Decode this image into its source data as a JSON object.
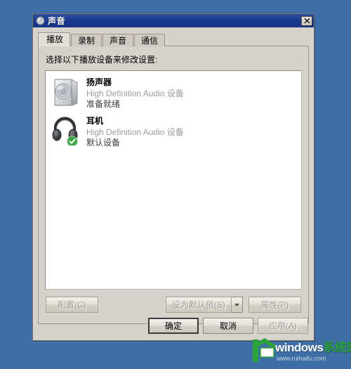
{
  "desktop": {
    "background_color": "#3d6ea5"
  },
  "window": {
    "title": "声音",
    "icon": "sound-speaker-icon",
    "close_label": "×"
  },
  "tabs": [
    {
      "label": "播放",
      "active": true
    },
    {
      "label": "录制",
      "active": false
    },
    {
      "label": "声音",
      "active": false
    },
    {
      "label": "通信",
      "active": false
    }
  ],
  "playback": {
    "instruction": "选择以下播放设备来修改设置:",
    "devices": [
      {
        "name": "扬声器",
        "description": "High Definition Audio 设备",
        "status": "准备就绪",
        "icon": "speaker-icon",
        "default": false,
        "meter_segments": 9
      },
      {
        "name": "耳机",
        "description": "High Definition Audio 设备",
        "status": "默认设备",
        "icon": "headphones-icon",
        "default": true,
        "meter_segments": 9
      }
    ],
    "buttons": {
      "configure": "配置(C)",
      "set_default": "设为默认值(S)",
      "set_default_arrow": "▼",
      "properties": "属性(P)"
    }
  },
  "dialog_buttons": {
    "ok": "确定",
    "cancel": "取消",
    "apply": "应用(A)"
  },
  "watermark": {
    "brand_en": "windows",
    "brand_cn": "系统家园",
    "url": "www.ruihaifu.com",
    "accent_color": "#2aa33a"
  }
}
